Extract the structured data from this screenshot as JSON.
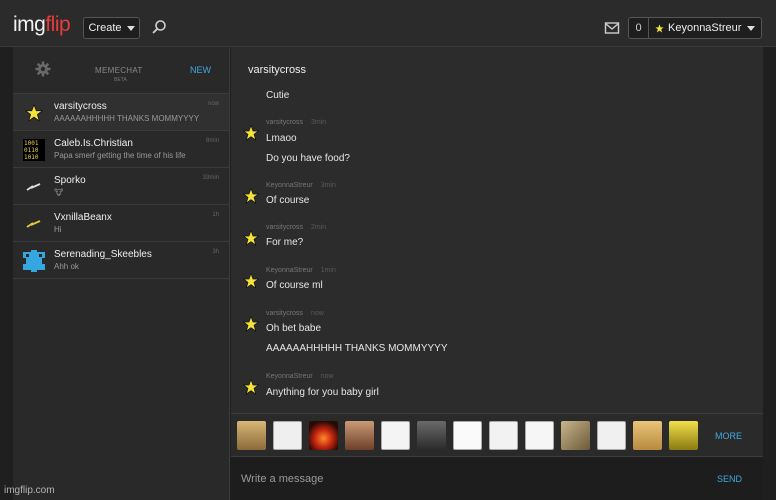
{
  "header": {
    "logo_img": "img",
    "logo_flip": "flip",
    "create_label": "Create",
    "notification_count": "0",
    "username": "KeyonnaStreur",
    "icons": [
      "search-icon",
      "mail-icon",
      "star-icon"
    ]
  },
  "memechat": {
    "title": "MEMECHAT",
    "beta": "BETA",
    "new_label": "NEW",
    "chats": [
      {
        "name": "varsitycross",
        "preview": "AAAAAAHHHHH THANKS MOMMYYYY",
        "time": "now"
      },
      {
        "name": "Caleb.Is.Christian",
        "preview": "Papa smerf getting the time of his life",
        "time": "8min"
      },
      {
        "name": "Sporko",
        "preview": "🐮",
        "time": "33min"
      },
      {
        "name": "VxnillaBeanx",
        "preview": "Hi",
        "time": "1h"
      },
      {
        "name": "Serenading_Skeebles",
        "preview": "Ahh ok",
        "time": "3h"
      }
    ]
  },
  "conversation": {
    "title": "varsitycross",
    "messages": [
      {
        "author": "",
        "time": "",
        "lines": [
          "Cutie"
        ]
      },
      {
        "author": "varsitycross",
        "time": "3min",
        "lines": [
          "Lmaoo",
          "Do you have food?"
        ]
      },
      {
        "author": "KeyonnaStreur",
        "time": "3min",
        "lines": [
          "Of course"
        ]
      },
      {
        "author": "varsitycross",
        "time": "2min",
        "lines": [
          "For me?"
        ]
      },
      {
        "author": "KeyonnaStreur",
        "time": "1min",
        "lines": [
          "Of course ml"
        ]
      },
      {
        "author": "varsitycross",
        "time": "now",
        "lines": [
          "Oh bet babe",
          "AAAAAAHHHHH THANKS MOMMYYYY"
        ]
      },
      {
        "author": "KeyonnaStreur",
        "time": "now",
        "lines": [
          "Anything for you baby girl"
        ]
      }
    ]
  },
  "meme_bar": {
    "more_label": "MORE",
    "memes": [
      "cat-meme",
      "troll-face-meme",
      "explosion-meme",
      "jesus-meme",
      "rage-face-meme",
      "dark-meme",
      "me-gusta-meme",
      "derp-meme",
      "trollface-grin-meme",
      "doge-glasses-meme",
      "forever-alone-meme",
      "doge-meme",
      "spongebob-meme"
    ]
  },
  "composer": {
    "placeholder": "Write a message",
    "send_label": "SEND"
  },
  "watermark": "imgflip.com",
  "colors": {
    "accent": "#3fa9e0",
    "logo_red": "#e83b3b",
    "star": "#f5e23a"
  }
}
